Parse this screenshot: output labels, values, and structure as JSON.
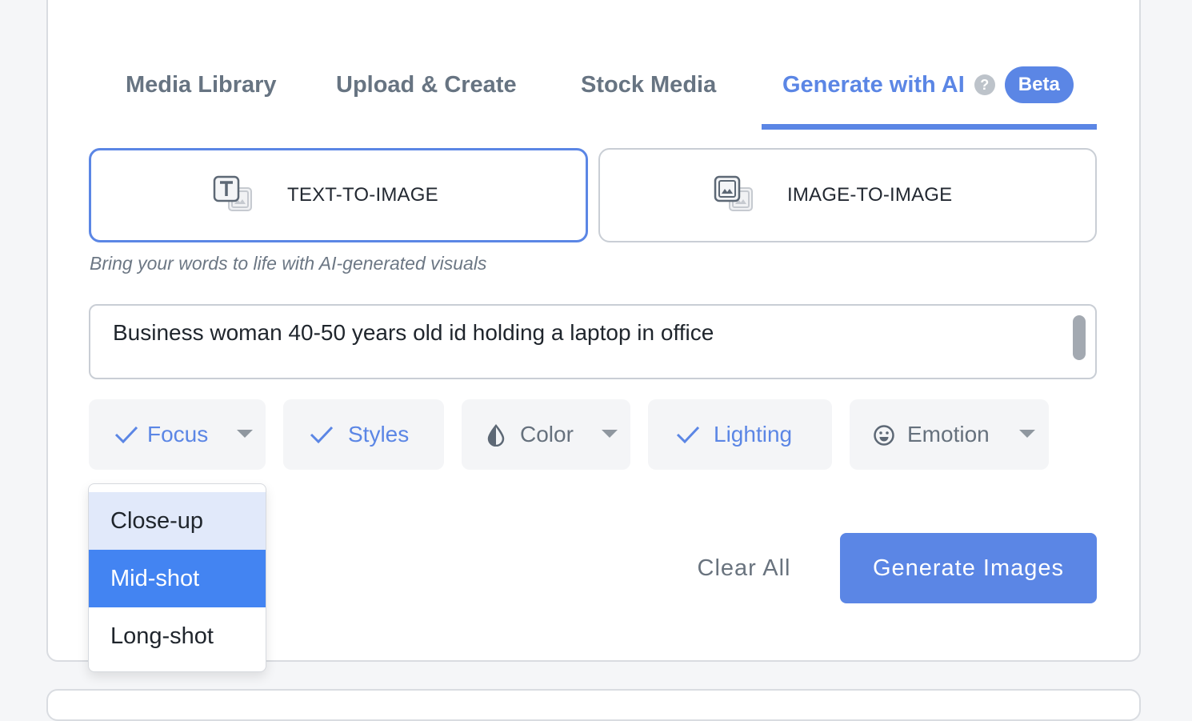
{
  "tabs": [
    {
      "label": "Media Library",
      "active": false
    },
    {
      "label": "Upload & Create",
      "active": false
    },
    {
      "label": "Stock Media",
      "active": false
    },
    {
      "label": "Generate with AI",
      "active": true,
      "badge": "Beta",
      "help_icon": "question-circle-icon"
    }
  ],
  "modes": [
    {
      "label": "TEXT-TO-IMAGE",
      "icon": "text-to-image-icon",
      "active": true
    },
    {
      "label": "IMAGE-TO-IMAGE",
      "icon": "image-to-image-icon",
      "active": false
    }
  ],
  "subtitle": "Bring your words to life with AI-generated visuals",
  "prompt": {
    "value": "Business woman 40-50 years old id holding a laptop in office"
  },
  "filters": [
    {
      "label": "Focus",
      "icon": "check-icon",
      "checked": true,
      "has_dropdown": true
    },
    {
      "label": "Styles",
      "icon": "check-icon",
      "checked": true,
      "has_dropdown": false
    },
    {
      "label": "Color",
      "icon": "water-drop-icon",
      "checked": false,
      "has_dropdown": true
    },
    {
      "label": "Lighting",
      "icon": "check-icon",
      "checked": true,
      "has_dropdown": false
    },
    {
      "label": "Emotion",
      "icon": "smiley-icon",
      "checked": false,
      "has_dropdown": true
    }
  ],
  "focus_dropdown": {
    "options": [
      "Close-up",
      "Mid-shot",
      "Long-shot"
    ],
    "selected": "Mid-shot",
    "hovered": "Close-up"
  },
  "actions": {
    "clear_label": "Clear All",
    "generate_label": "Generate Images"
  },
  "colors": {
    "accent": "#5b86e5",
    "selected_option": "#4384f2",
    "hover_option": "#e1e9fa",
    "muted_text": "#677482"
  }
}
